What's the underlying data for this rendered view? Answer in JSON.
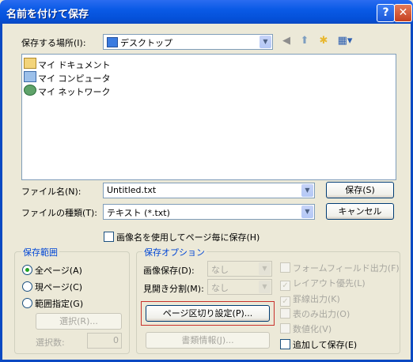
{
  "window": {
    "title": "名前を付けて保存",
    "help_label": "?",
    "close_label": "✕"
  },
  "location": {
    "label": "保存する場所(I):",
    "value": "デスクトップ"
  },
  "toolbar": {
    "back_icon": "back-arrow-icon",
    "up_icon": "up-folder-icon",
    "new_folder_icon": "new-folder-icon",
    "view_menu_icon": "view-menu-icon"
  },
  "files": [
    {
      "name": "マイ ドキュメント",
      "icon": "my-documents-icon"
    },
    {
      "name": "マイ コンピュータ",
      "icon": "my-computer-icon"
    },
    {
      "name": "マイ ネットワーク",
      "icon": "my-network-icon"
    }
  ],
  "filename": {
    "label": "ファイル名(N):",
    "value": "Untitled.txt"
  },
  "filetype": {
    "label": "ファイルの種類(T):",
    "value": "テキスト (*.txt)"
  },
  "buttons": {
    "save": "保存(S)",
    "cancel": "キャンセル"
  },
  "image_name_option": {
    "label": "画像名を使用してページ毎に保存(H)",
    "checked": false
  },
  "range_group": {
    "title": "保存範囲",
    "options": [
      {
        "label": "全ページ(A)",
        "selected": true
      },
      {
        "label": "現ページ(C)",
        "selected": false
      },
      {
        "label": "範囲指定(G)",
        "selected": false
      }
    ],
    "select_button": "選択(R)...",
    "count_label": "選択数:",
    "count_value": "0"
  },
  "options_group": {
    "title": "保存オプション",
    "image_save": {
      "label": "画像保存(D):",
      "value": "なし"
    },
    "spread_split": {
      "label": "見開き分割(M):",
      "value": "なし"
    },
    "page_split_button": "ページ区切り設定(P)...",
    "doc_info_button": "書類情報(J)...",
    "checks": [
      {
        "label": "フォームフィールド出力(F)",
        "checked": false,
        "enabled": false
      },
      {
        "label": "レイアウト優先(L)",
        "checked": true,
        "enabled": false
      },
      {
        "label": "罫線出力(K)",
        "checked": true,
        "enabled": false
      },
      {
        "label": "表のみ出力(O)",
        "checked": false,
        "enabled": false
      },
      {
        "label": "数値化(V)",
        "checked": false,
        "enabled": false
      },
      {
        "label": "追加して保存(E)",
        "checked": false,
        "enabled": true
      }
    ]
  },
  "colors": {
    "titlebar": "#0a5ae6",
    "highlight_border": "#c8312b",
    "group_title": "#0046d5"
  }
}
